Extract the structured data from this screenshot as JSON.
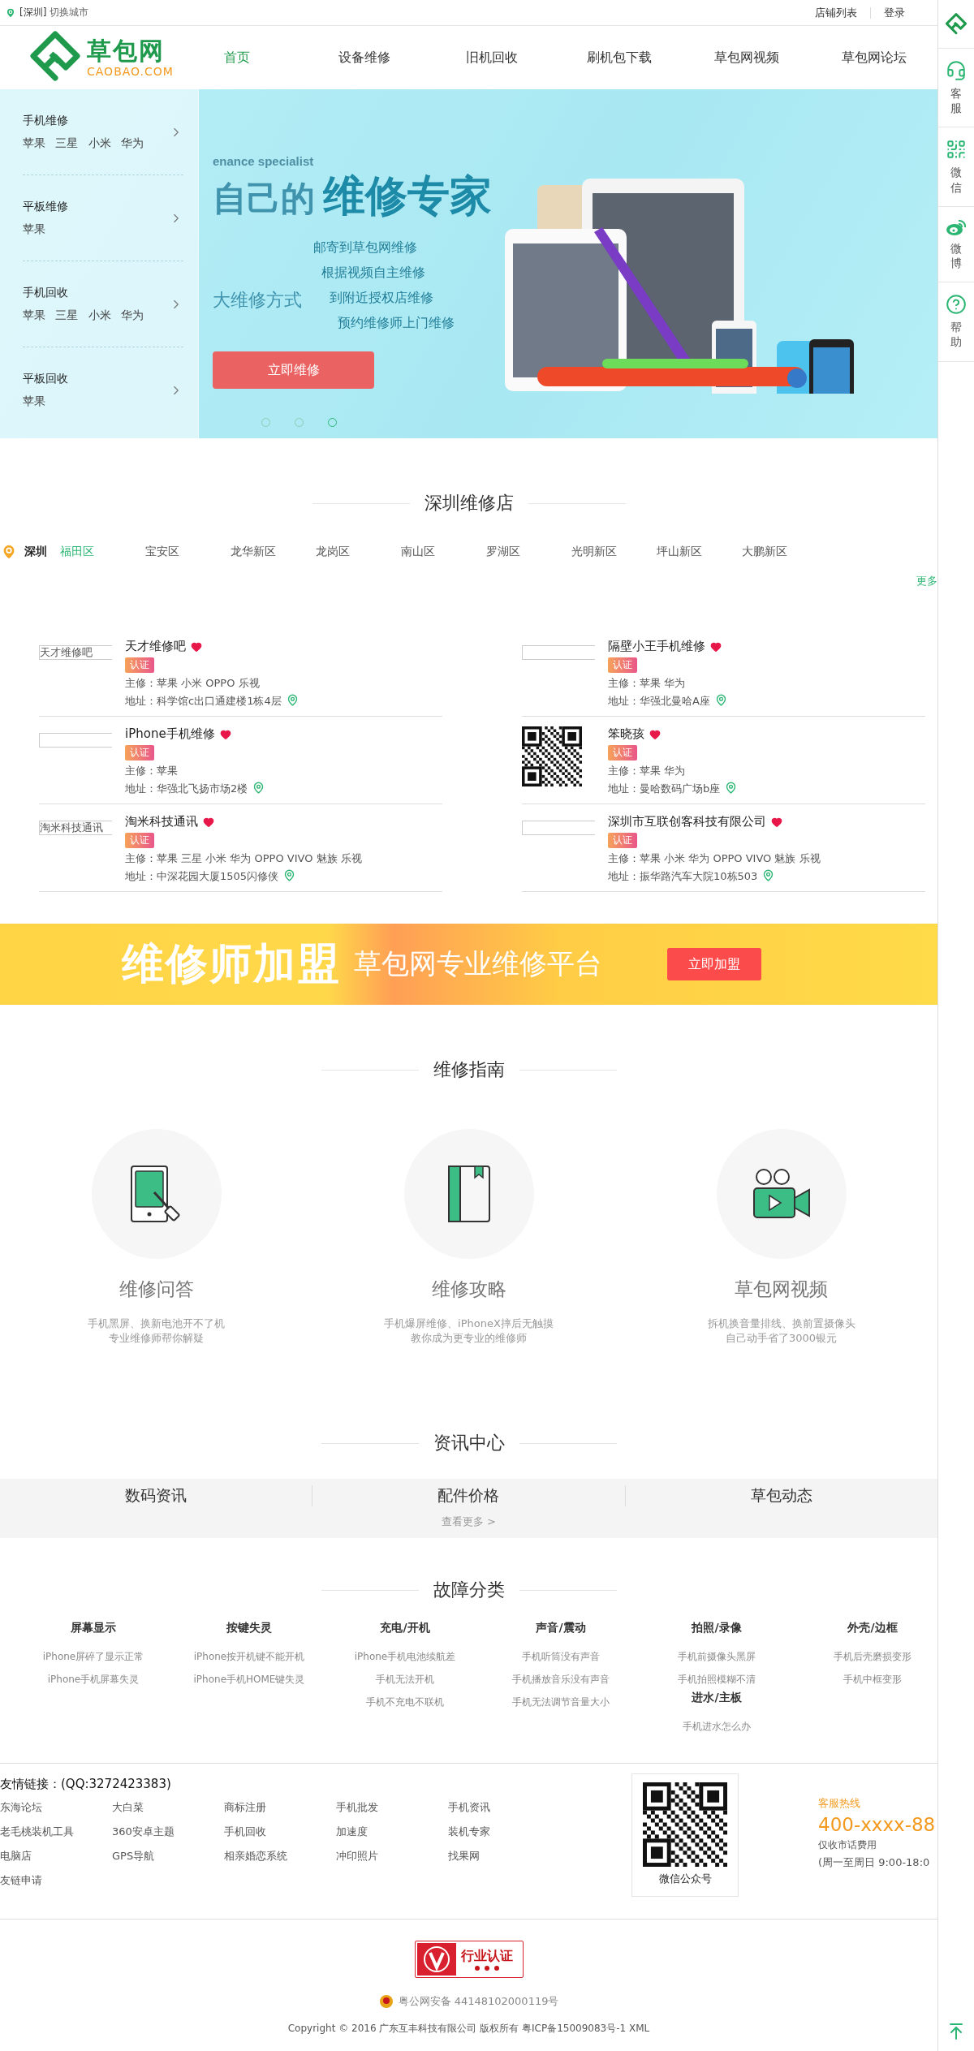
{
  "top_bar": {
    "city": "[深圳]",
    "switch_city": "切换城市",
    "links": [
      "店铺列表",
      "登录"
    ]
  },
  "logo": {
    "name": "草包网",
    "domain": "CAOBAO.COM"
  },
  "nav": [
    {
      "label": "首页",
      "selected": true
    },
    {
      "label": "设备维修",
      "selected": false
    },
    {
      "label": "旧机回收",
      "selected": false
    },
    {
      "label": "刷机包下载",
      "selected": false
    },
    {
      "label": "草包网视频",
      "selected": false
    },
    {
      "label": "草包网论坛",
      "selected": false
    }
  ],
  "hero": {
    "menu": [
      {
        "title": "手机维修",
        "items": [
          "苹果",
          "三星",
          "小米",
          "华为"
        ]
      },
      {
        "title": "平板维修",
        "items": [
          "苹果"
        ]
      },
      {
        "title": "手机回收",
        "items": [
          "苹果",
          "三星",
          "小米",
          "华为"
        ]
      },
      {
        "title": "平板回收",
        "items": [
          "苹果"
        ]
      }
    ],
    "tagline": "enance specialist",
    "headline_a": "自己的",
    "headline_b": "维修专家",
    "side_text": "大维修方式",
    "bullets": [
      "邮寄到草包网维修",
      "根据视频自主维修",
      "到附近授权店维修",
      "预约维修师上门维修"
    ],
    "button": "立即维修",
    "dots": [
      {
        "selected": false
      },
      {
        "selected": false
      },
      {
        "selected": true
      }
    ]
  },
  "shops_section": {
    "title": "深圳维修店",
    "city": "深圳",
    "more": "更多",
    "districts": [
      {
        "label": "福田区",
        "selected": true
      },
      {
        "label": "宝安区",
        "selected": false
      },
      {
        "label": "龙华新区",
        "selected": false
      },
      {
        "label": "龙岗区",
        "selected": false
      },
      {
        "label": "南山区",
        "selected": false
      },
      {
        "label": "罗湖区",
        "selected": false
      },
      {
        "label": "光明新区",
        "selected": false
      },
      {
        "label": "坪山新区",
        "selected": false
      },
      {
        "label": "大鹏新区",
        "selected": false
      }
    ],
    "shops": [
      {
        "thumb": {
          "kind": "broken",
          "alt": "天才维修吧"
        },
        "name": "天才维修吧",
        "badge": "认证",
        "specialty": "主修：苹果 小米 OPPO 乐视",
        "address": "地址：科学馆c出口通建楼1栋4层"
      },
      {
        "thumb": {
          "kind": "broken"
        },
        "name": "隔壁小王手机维修",
        "badge": "认证",
        "specialty": "主修：苹果 华为",
        "address": "地址：华强北曼哈A座"
      },
      {
        "thumb": {
          "kind": "broken"
        },
        "name": "iPhone手机维修",
        "badge": "认证",
        "specialty": "主修：苹果",
        "address": "地址：华强北飞扬市场2楼"
      },
      {
        "thumb": {
          "kind": "qr"
        },
        "name": "笨晓孩",
        "badge": "认证",
        "specialty": "主修：苹果 华为",
        "address": "地址：曼哈数码广场b座"
      },
      {
        "thumb": {
          "kind": "broken",
          "alt": "淘米科技通讯"
        },
        "name": "淘米科技通讯",
        "badge": "认证",
        "specialty": "主修：苹果 三星 小米 华为 OPPO VIVO 魅族 乐视",
        "address": "地址：中深花园大厦1505闪修侠"
      },
      {
        "thumb": {
          "kind": "broken"
        },
        "name": "深圳市互联创客科技有限公司",
        "badge": "认证",
        "specialty": "主修：苹果 小米 华为 OPPO VIVO 魅族 乐视",
        "address": "地址：振华路汽车大院10栋503"
      }
    ]
  },
  "banner": {
    "headline": "维修师加盟",
    "subtitle": "草包网专业维修平台",
    "button": "立即加盟"
  },
  "guide": {
    "title": "维修指南",
    "items": [
      {
        "kind": "phone",
        "title": "维修问答",
        "lines": [
          "手机黑屏、换新电池开不了机",
          "专业维修师帮你解疑"
        ]
      },
      {
        "kind": "book",
        "title": "维修攻略",
        "lines": [
          "手机爆屏维修、iPhoneX摔后无触摸",
          "教你成为更专业的维修师"
        ]
      },
      {
        "kind": "video",
        "title": "草包网视频",
        "lines": [
          "拆机换音量排线、换前置摄像头",
          "自己动手省了3000银元"
        ]
      }
    ]
  },
  "news": {
    "title": "资讯中心",
    "tabs": [
      "数码资讯",
      "配件价格",
      "草包动态"
    ],
    "more": "查看更多 >"
  },
  "faults": {
    "title": "故障分类",
    "columns": [
      [
        {
          "title": "屏幕显示",
          "items": [
            "iPhone屏碎了显示正常",
            "iPhone手机屏幕失灵"
          ]
        }
      ],
      [
        {
          "title": "按键失灵",
          "items": [
            "iPhone按开机键不能开机",
            "iPhone手机HOME键失灵"
          ]
        }
      ],
      [
        {
          "title": "充电/开机",
          "items": [
            "iPhone手机电池续航差",
            "手机无法开机",
            "手机不充电不联机"
          ]
        }
      ],
      [
        {
          "title": "声音/震动",
          "items": [
            "手机听筒没有声音",
            "手机播放音乐没有声音",
            "手机无法调节音量大小"
          ]
        }
      ],
      [
        {
          "title": "拍照/录像",
          "items": [
            "手机前摄像头黑屏",
            "手机拍照模糊不清"
          ]
        },
        {
          "title": "进水/主板",
          "items": [
            "手机进水怎么办"
          ]
        }
      ],
      [
        {
          "title": "外壳/边框",
          "items": [
            "手机后壳磨损变形",
            "手机中框变形"
          ]
        }
      ]
    ]
  },
  "footer": {
    "links_title": "友情链接：(QQ:3272423383)",
    "links": [
      "东海论坛",
      "大白菜",
      "商标注册",
      "手机批发",
      "手机资讯",
      "老毛桃装机工具",
      "360安卓主题",
      "手机回收",
      "加速度",
      "装机专家",
      "电脑店",
      "GPS导航",
      "相亲婚恋系统",
      "冲印照片",
      "找果网",
      "友链申请"
    ],
    "qr_caption": "微信公众号",
    "hotline": {
      "label": "客服热线",
      "number": "400-xxxx-88",
      "note": "仅收市话费用",
      "hours": "(周一至周日 9:00-18:0"
    },
    "cert": "行业认证",
    "police": "粤公网安备 44148102000119号",
    "copyright": "Copyright © 2016 广东互丰科技有限公司 版权所有 粤ICP备15009083号-1 XML"
  },
  "sidebar": [
    {
      "kind": "service",
      "label": "客服"
    },
    {
      "kind": "wechat",
      "label": "微信"
    },
    {
      "kind": "weibo",
      "label": "微博"
    },
    {
      "kind": "help",
      "label": "帮助"
    }
  ]
}
